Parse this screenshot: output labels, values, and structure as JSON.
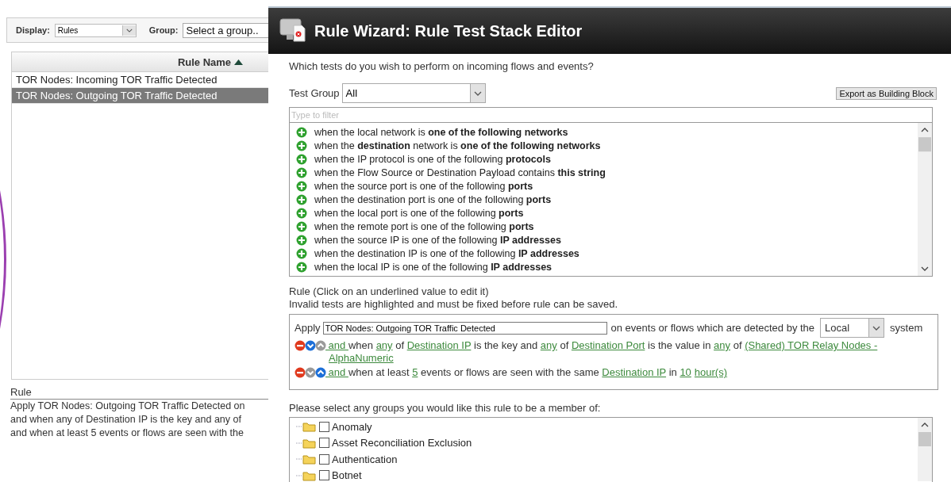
{
  "left_panel": {
    "toolbar": {
      "display_label": "Display:",
      "display_value": "Rules",
      "group_label": "Group:",
      "group_placeholder": "Select a group.."
    },
    "table": {
      "columns": [
        {
          "label": "Rule Name",
          "sorted": true,
          "ascending": true
        }
      ],
      "rows": [
        {
          "name": "TOR Nodes: Incoming TOR Traffic Detected",
          "selected": false
        },
        {
          "name": "TOR Nodes: Outgoing TOR Traffic Detected",
          "selected": true
        }
      ]
    },
    "detail": {
      "heading": "Rule",
      "lines": [
        "Apply TOR Nodes: Outgoing TOR Traffic Detected on",
        "and when any of Destination IP is the key and any of",
        "and when at least 5 events or flows are seen with the"
      ]
    }
  },
  "dialog": {
    "title": "Rule Wizard: Rule Test Stack Editor",
    "prompt": "Which tests do you wish to perform on incoming flows and events?",
    "test_group": {
      "label": "Test Group",
      "value": "All"
    },
    "export_button": "Export as Building Block",
    "filter": {
      "placeholder": "Type to filter"
    },
    "tests": [
      "when the local network is **one of the following networks**",
      "when the **destination** network is **one of the following networks**",
      "when the IP protocol is one of the following **protocols**",
      "when the Flow Source or Destination Payload contains **this string**",
      "when the source port is one of the following **ports**",
      "when the destination port is one of the following **ports**",
      "when the local port is one of the following **ports**",
      "when the remote port is one of the following **ports**",
      "when the source IP is one of the following **IP addresses**",
      "when the destination IP is one of the following **IP addresses**",
      "when the local IP is one of the following **IP addresses**"
    ],
    "rule": {
      "heading": "Rule (Click on an underlined value to edit it)",
      "note": "Invalid tests are highlighted and must be fixed before rule can be saved.",
      "apply_label": "Apply",
      "name_value": "TOR Nodes: Outgoing TOR Traffic Detected",
      "detected_text": "on events or flows which are detected by the",
      "system_select": "Local",
      "system_label": "system",
      "tests": [
        {
          "can_move_down": true,
          "can_move_up": false,
          "segments": [
            {
              "text": " and ",
              "link": true
            },
            {
              "text": "when ",
              "link": false
            },
            {
              "text": "any",
              "link": true
            },
            {
              "text": " of ",
              "link": false
            },
            {
              "text": "Destination IP",
              "link": true
            },
            {
              "text": " is the key and ",
              "link": false
            },
            {
              "text": "any",
              "link": true
            },
            {
              "text": " of ",
              "link": false
            },
            {
              "text": "Destination Port",
              "link": true
            },
            {
              "text": " is the value in ",
              "link": false
            },
            {
              "text": "any",
              "link": true
            },
            {
              "text": " of ",
              "link": false
            },
            {
              "text": "(Shared) TOR Relay Nodes -",
              "link": true
            },
            {
              "text": "AlphaNumeric",
              "link": true
            }
          ]
        },
        {
          "can_move_down": false,
          "can_move_up": true,
          "segments": [
            {
              "text": " and ",
              "link": true
            },
            {
              "text": "when at least ",
              "link": false
            },
            {
              "text": "5",
              "link": true
            },
            {
              "text": " events or flows are seen with the same ",
              "link": false
            },
            {
              "text": "Destination IP",
              "link": true
            },
            {
              "text": " in ",
              "link": false
            },
            {
              "text": "10",
              "link": true
            },
            {
              "text": "hour(s)",
              "link": true
            }
          ]
        }
      ]
    },
    "groups": {
      "prompt": "Please select any groups you would like this rule to be a member of:",
      "items": [
        {
          "label": "Anomaly",
          "checked": false
        },
        {
          "label": "Asset Reconciliation Exclusion",
          "checked": false
        },
        {
          "label": "Authentication",
          "checked": false
        },
        {
          "label": "Botnet",
          "checked": false
        }
      ]
    }
  }
}
